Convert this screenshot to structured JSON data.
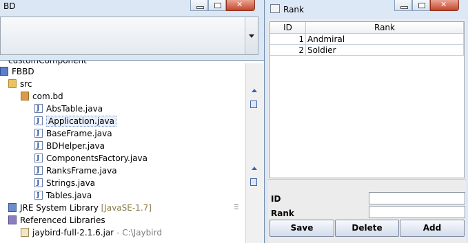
{
  "explorer": {
    "partial_top": "customComponent",
    "project": "FBBD",
    "src": "src",
    "package": "com.bd",
    "files": [
      "AbsTable.java",
      "Application.java",
      "BaseFrame.java",
      "BDHelper.java",
      "ComponentsFactory.java",
      "RanksFrame.java",
      "Strings.java",
      "Tables.java"
    ],
    "jre": "JRE System Library",
    "jre_version": "[JavaSE-1.7]",
    "ref_libs": "Referenced Libraries",
    "jar": "jaybird-full-2.1.6.jar",
    "jar_path": "- C:\\Jaybird"
  },
  "combo_window": {
    "title": "BD",
    "combo_value": ""
  },
  "rank_window": {
    "title": "Rank",
    "table": {
      "columns": [
        "ID",
        "Rank"
      ],
      "rows": [
        {
          "id": "1",
          "rank": "Andmiral"
        },
        {
          "id": "2",
          "rank": "Soldier"
        }
      ]
    },
    "form": {
      "id_label": "ID",
      "rank_label": "Rank",
      "id_value": "",
      "rank_value": ""
    },
    "buttons": {
      "save": "Save",
      "delete": "Delete",
      "add": "Add"
    }
  },
  "icons": [
    "java-file-icon",
    "folder-icon",
    "package-icon",
    "project-icon",
    "library-icon",
    "jar-icon",
    "minimize-icon",
    "maximize-icon",
    "close-icon",
    "dropdown-arrow-icon",
    "window-app-icon"
  ],
  "colors": {
    "window_frame": "#dde8f6",
    "close_button": "#c4452a",
    "selection": "#e7eefb"
  }
}
